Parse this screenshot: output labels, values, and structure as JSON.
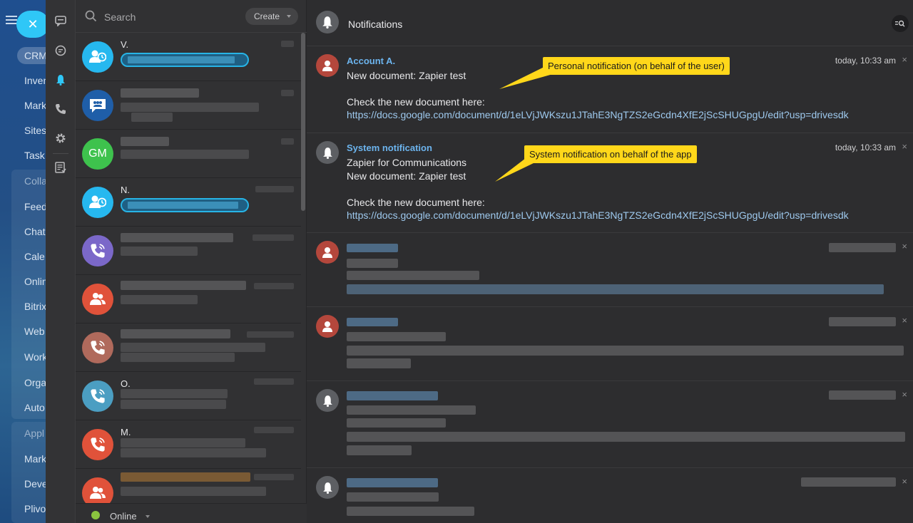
{
  "appnav": {
    "items": [
      "CRM",
      "Inven",
      "Mark",
      "Sites",
      "Task",
      "Colla",
      "Feed",
      "Chat",
      "Cale",
      "Onlin",
      "Bitrix",
      "Web",
      "Work",
      "Orga",
      "Auto",
      "Appl",
      "Mark",
      "Deve",
      "Plivo"
    ]
  },
  "search": {
    "placeholder": "Search"
  },
  "create_label": "Create",
  "chats": [
    {
      "name": "V.",
      "initials": "",
      "color": "#26b8ef",
      "icon": "user-clock-icon"
    },
    {
      "name": "",
      "initials": "",
      "color": "#1f5ea8",
      "icon": "group-chat-icon"
    },
    {
      "name": "",
      "initials": "GM",
      "color": "#3ec24d",
      "icon": ""
    },
    {
      "name": "N.",
      "initials": "",
      "color": "#26b8ef",
      "icon": "user-clock-icon"
    },
    {
      "name": "",
      "initials": "",
      "color": "#7b68c9",
      "icon": "phone-icon"
    },
    {
      "name": "",
      "initials": "",
      "color": "#e0523a",
      "icon": "users-icon"
    },
    {
      "name": "",
      "initials": "",
      "color": "#b06a5c",
      "icon": "phone-icon"
    },
    {
      "name": "O.",
      "initials": "",
      "color": "#4b9ec2",
      "icon": "phone-icon"
    },
    {
      "name": "M.",
      "initials": "",
      "color": "#e0523a",
      "icon": "phone-icon"
    },
    {
      "name": "",
      "initials": "",
      "color": "#e0523a",
      "icon": "users-icon"
    }
  ],
  "status": {
    "label": "Online",
    "color": "#8ac43f"
  },
  "panel": {
    "title": "Notifications",
    "notifications": [
      {
        "author": "Account A.",
        "time": "today, 10:33 am",
        "lines": [
          "New document: Zapier test",
          "",
          "Check the new document here:"
        ],
        "link": "https://docs.google.com/document/d/1eLVjJWKszu1JTahE3NgTZS2eGcdn4XfE2jScSHUGpgU/edit?usp=drivesdk"
      },
      {
        "author": "System notification",
        "time": "today, 10:33 am",
        "lines": [
          "Zapier for Communications",
          "New document: Zapier test",
          "",
          "Check the new document here:"
        ],
        "link": "https://docs.google.com/document/d/1eLVjJWKszu1JTahE3NgTZS2eGcdn4XfE2jScSHUGpgU/edit?usp=drivesdk"
      }
    ]
  },
  "callouts": {
    "personal": "Personal notification (on behalf of the user)",
    "system": "System notification on behalf of the app"
  },
  "close_glyph": "×"
}
